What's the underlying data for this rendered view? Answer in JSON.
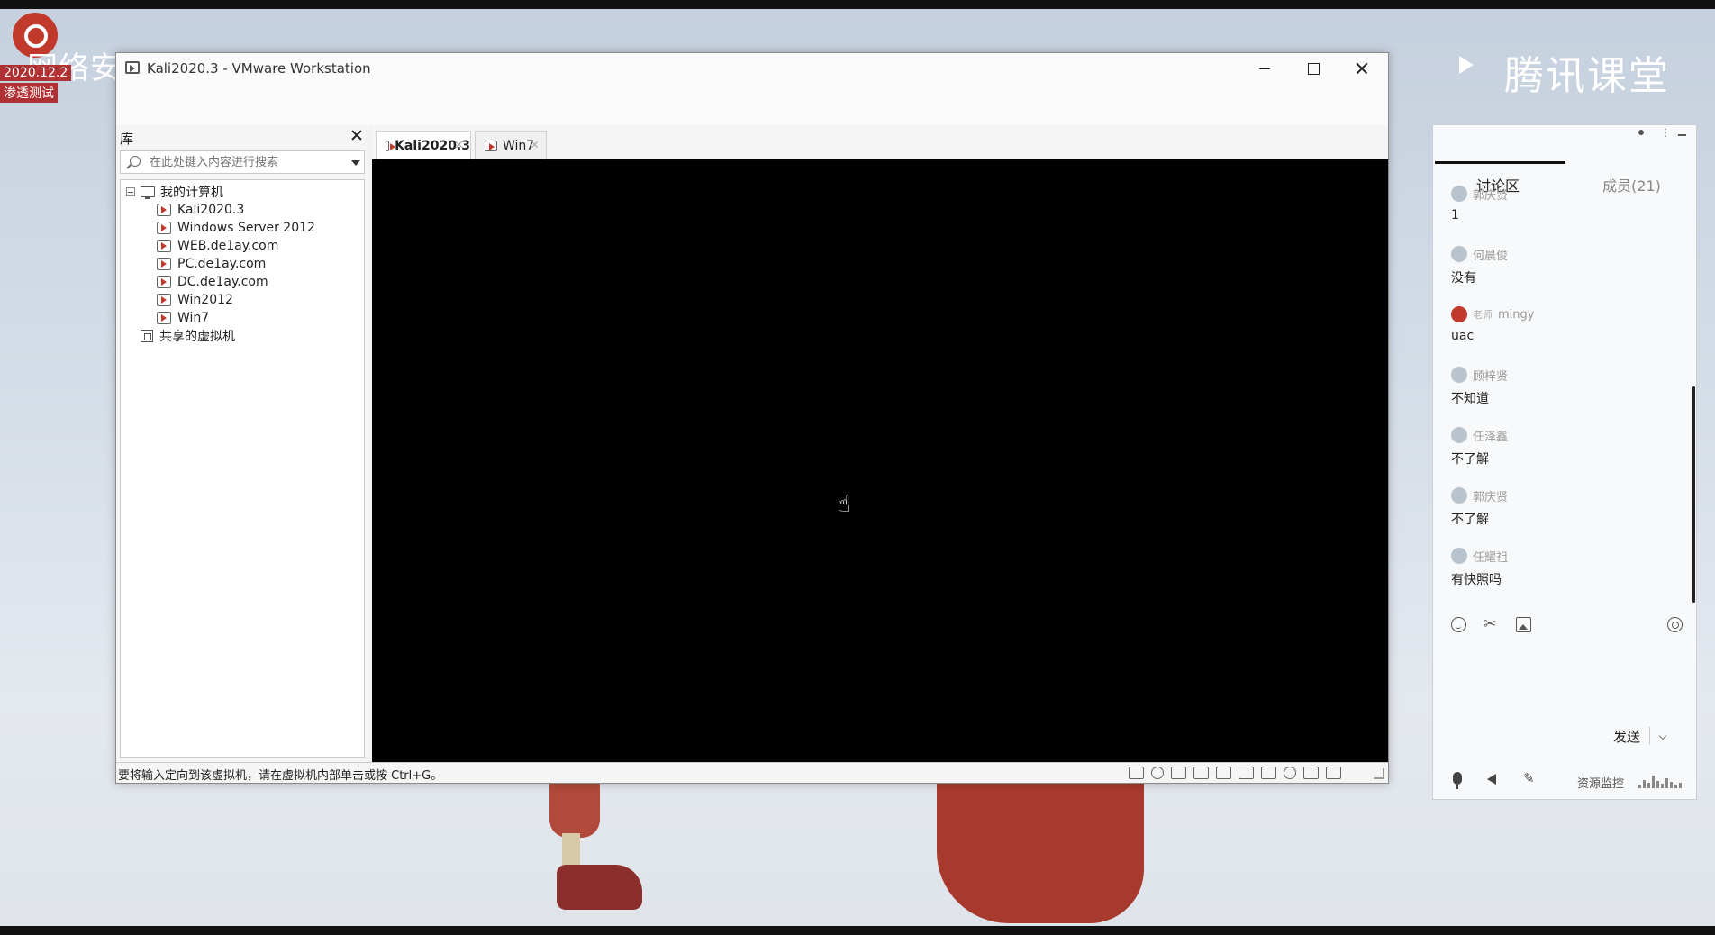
{
  "background": {
    "overlay_title": "网络安全",
    "overlay_date": "2020.12.2",
    "overlay_sub": "渗透测试",
    "brand": "腾讯课堂"
  },
  "window": {
    "title": "Kali2020.3 - VMware Workstation"
  },
  "library": {
    "header": "库",
    "search_placeholder": "在此处键入内容进行搜索",
    "root_label": "我的计算机",
    "items": [
      {
        "label": "Kali2020.3"
      },
      {
        "label": "Windows Server 2012"
      },
      {
        "label": "WEB.de1ay.com"
      },
      {
        "label": "PC.de1ay.com"
      },
      {
        "label": "DC.de1ay.com"
      },
      {
        "label": "Win2012"
      },
      {
        "label": "Win7"
      }
    ],
    "shared_label": "共享的虚拟机"
  },
  "tabs": [
    {
      "label": "Kali2020.3",
      "active": true
    },
    {
      "label": "Win7",
      "active": false
    }
  ],
  "status": {
    "text": "要将输入定向到该虚拟机，请在虚拟机内部单击或按 Ctrl+G。"
  },
  "chat": {
    "tabs": {
      "discussion": "讨论区",
      "members": "成员(21)"
    },
    "messages": [
      {
        "name": "郭庆贤",
        "text": "1"
      },
      {
        "name": "何晨俊",
        "text": "没有"
      },
      {
        "name": "mingy",
        "tag": "老师",
        "text": "uac",
        "teacher": true
      },
      {
        "name": "顾梓贤",
        "text": "不知道"
      },
      {
        "name": "任泽鑫",
        "text": "不了解"
      },
      {
        "name": "郭庆贤",
        "text": "不了解"
      },
      {
        "name": "任耀祖",
        "text": "有快照吗"
      }
    ],
    "send_label": "发送",
    "monitor_label": "资源监控"
  },
  "colors": {
    "accent_red": "#c0392b",
    "console_bg": "#000000"
  }
}
